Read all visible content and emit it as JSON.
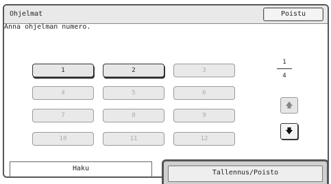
{
  "window": {
    "title": "Ohjelmat",
    "exit_label": "Poistu"
  },
  "prompt": "Anna ohjelman numero.",
  "keys": [
    {
      "label": "1",
      "enabled": true
    },
    {
      "label": "2",
      "enabled": true
    },
    {
      "label": "3",
      "enabled": false
    },
    {
      "label": "4",
      "enabled": false
    },
    {
      "label": "5",
      "enabled": false
    },
    {
      "label": "6",
      "enabled": false
    },
    {
      "label": "7",
      "enabled": false
    },
    {
      "label": "8",
      "enabled": false
    },
    {
      "label": "9",
      "enabled": false
    },
    {
      "label": "10",
      "enabled": false
    },
    {
      "label": "11",
      "enabled": false
    },
    {
      "label": "12",
      "enabled": false
    }
  ],
  "pager": {
    "current": "1",
    "total": "4",
    "up_icon": "arrow-up-icon",
    "down_icon": "arrow-down-icon"
  },
  "tabs": [
    {
      "label": "Haku",
      "selected": false
    },
    {
      "label": "Tallennus/Poisto",
      "selected": true
    }
  ]
}
